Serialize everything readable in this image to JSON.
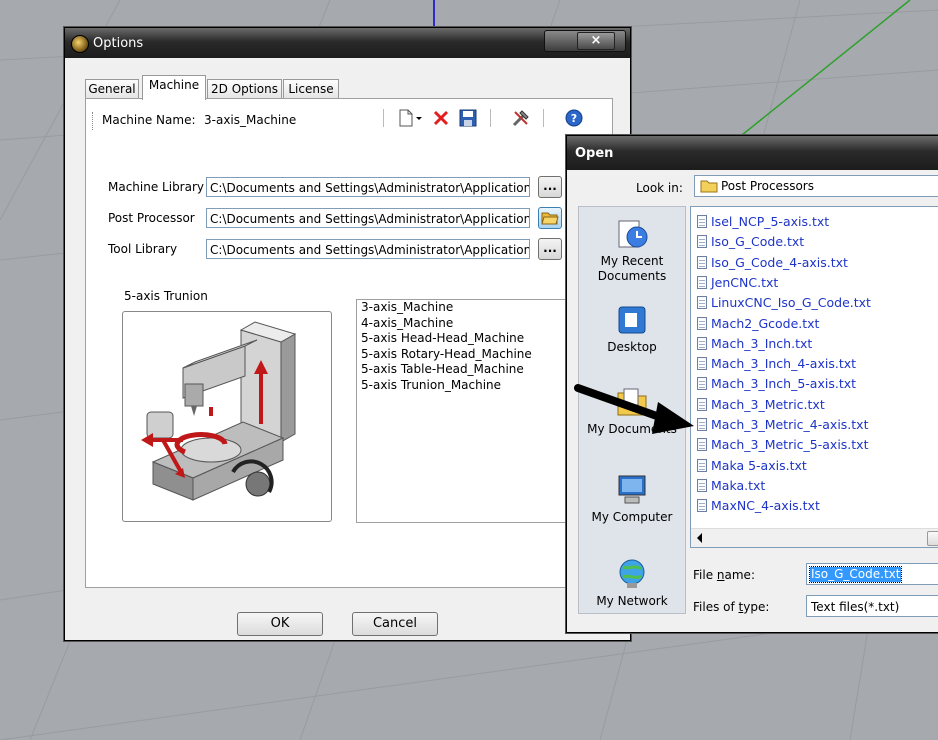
{
  "options_dialog": {
    "title": "Options",
    "close_label": "×",
    "tabs": [
      {
        "label": "General",
        "active": false
      },
      {
        "label": "Machine",
        "active": true
      },
      {
        "label": "2D Options",
        "active": false
      },
      {
        "label": "License",
        "active": false
      }
    ],
    "machine_name_label": "Machine Name:",
    "machine_name_value": "3-axis_Machine",
    "machine_library_label": "Machine Library",
    "machine_library_value": "C:\\Documents and Settings\\Administrator\\Application D",
    "post_processor_label": "Post Processor",
    "post_processor_value": "C:\\Documents and Settings\\Administrator\\Application D",
    "tool_library_label": "Tool Library",
    "tool_library_value": "C:\\Documents and Settings\\Administrator\\Application D",
    "browse_label": "...",
    "preview_caption": "5-axis Trunion",
    "machine_list": [
      "3-axis_Machine",
      "4-axis_Machine",
      "5-axis Head-Head_Machine",
      "5-axis Rotary-Head_Machine",
      "5-axis Table-Head_Machine",
      "5-axis Trunion_Machine"
    ],
    "ok_label": "OK",
    "cancel_label": "Cancel"
  },
  "open_dialog": {
    "title": "Open",
    "look_in_label": "Look in:",
    "look_in_value": "Post Processors",
    "places": [
      "My Recent Documents",
      "Desktop",
      "My Documents",
      "My Computer",
      "My Network"
    ],
    "files": [
      "Isel_NCP_5-axis.txt",
      "Iso_G_Code.txt",
      "Iso_G_Code_4-axis.txt",
      "JenCNC.txt",
      "LinuxCNC_Iso_G_Code.txt",
      "Mach2_Gcode.txt",
      "Mach_3_Inch.txt",
      "Mach_3_Inch_4-axis.txt",
      "Mach_3_Inch_5-axis.txt",
      "Mach_3_Metric.txt",
      "Mach_3_Metric_4-axis.txt",
      "Mach_3_Metric_5-axis.txt",
      "Maka 5-axis.txt",
      "Maka.txt",
      "MaxNC_4-axis.txt"
    ],
    "file_name_label": "File name:",
    "file_name_value": "Iso_G_Code.txt",
    "files_of_type_label": "Files of type:",
    "files_of_type_value": "Text files(*.txt)"
  },
  "colors": {
    "titlebar": "#1c1c1c",
    "file_link": "#1d34c8",
    "selection": "#3399ff",
    "viewport_bg": "#a6a9ae",
    "axis_blue": "#2b2bd0",
    "axis_green": "#2ca02c"
  }
}
